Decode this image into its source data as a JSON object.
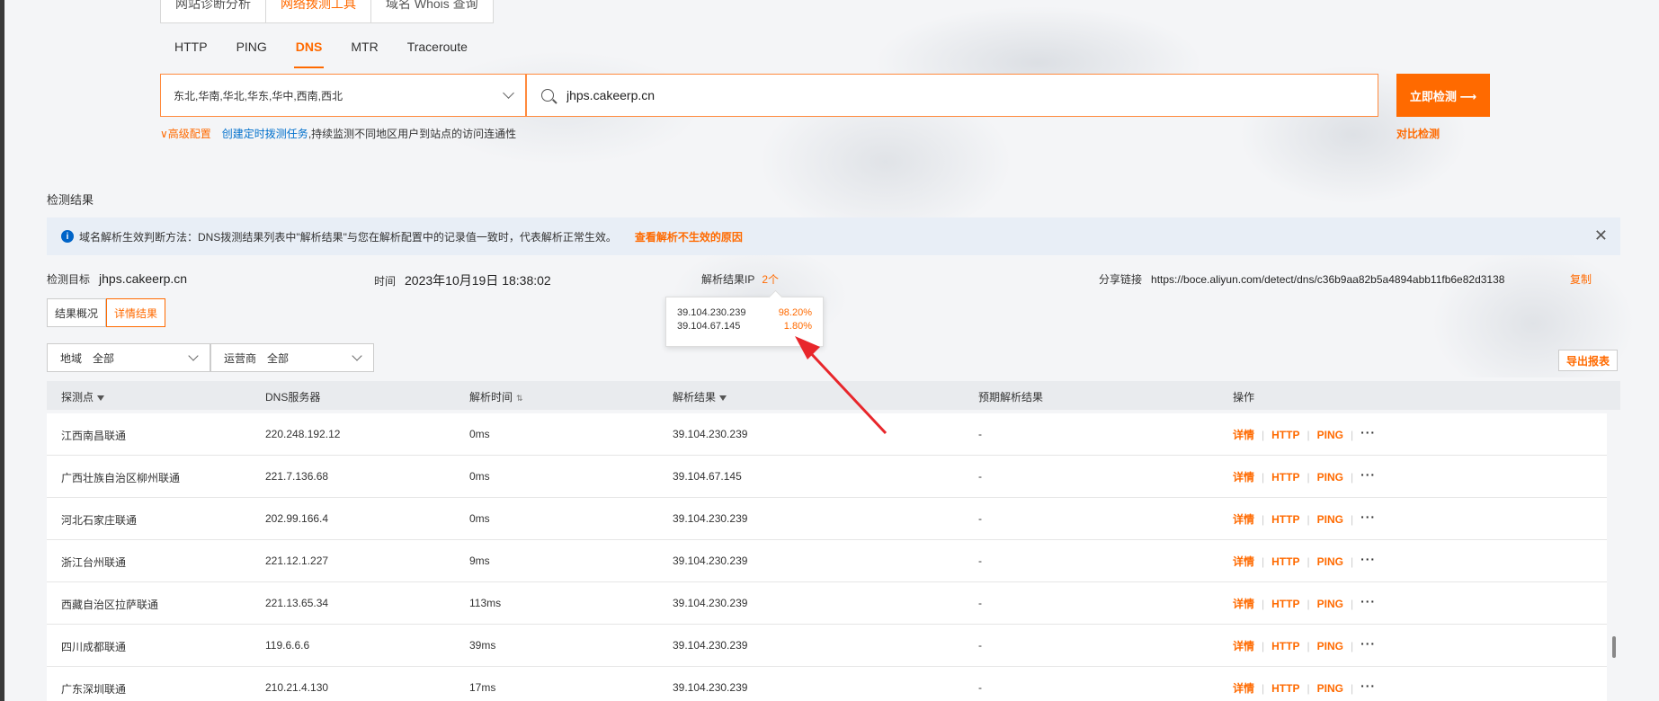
{
  "tool_tabs": [
    "网站诊断分析",
    "网络拨测工具",
    "域名 Whois 查询"
  ],
  "protocol_tabs": [
    "HTTP",
    "PING",
    "DNS",
    "MTR",
    "Traceroute"
  ],
  "region_select": {
    "value": "东北,华南,华北,华东,华中,西南,西北",
    "chevron_icon": "chevron-down-icon"
  },
  "target_input": {
    "value": "jhps.cakeerp.cn",
    "icon": "search-icon"
  },
  "detect_button": "立即检测 ⟶",
  "advanced_config": "∨高级配置",
  "schedule_link": "创建定时拨测任务",
  "schedule_desc": ",持续监测不同地区用户到站点的访问连通性",
  "compare_link": "对比检测",
  "section_title": "检测结果",
  "info_bar": {
    "icon": "info-icon",
    "text": "域名解析生效判断方法：DNS拨测结果列表中\"解析结果\"与您在解析配置中的记录值一致时，代表解析正常生效。",
    "reason_link": "查看解析不生效的原因",
    "close": "✕"
  },
  "meta": {
    "target_label": "检测目标",
    "target_value": "jhps.cakeerp.cn",
    "time_label": "时间",
    "time_value": "2023年10月19日 18:38:02",
    "ip_label": "解析结果IP",
    "ip_count": "2个",
    "share_label": "分享链接",
    "share_url": "https://boce.aliyun.com/detect/dns/c36b9aa82b5a4894abb11fb6e82d3138",
    "copy": "复制"
  },
  "view_toggle": [
    "结果概况",
    "详情结果"
  ],
  "filters": [
    {
      "label": "地域",
      "value": "全部"
    },
    {
      "label": "运营商",
      "value": "全部"
    }
  ],
  "export_button": "导出报表",
  "tooltip": [
    {
      "ip": "39.104.230.239",
      "pct": "98.20%"
    },
    {
      "ip": "39.104.67.145",
      "pct": "1.80%"
    }
  ],
  "table": {
    "headers": [
      "探测点",
      "DNS服务器",
      "解析时间",
      "解析结果",
      "预期解析结果",
      "操作"
    ],
    "rows": [
      [
        "江西南昌联通",
        "220.248.192.12",
        "0ms",
        "39.104.230.239",
        "-"
      ],
      [
        "广西壮族自治区柳州联通",
        "221.7.136.68",
        "0ms",
        "39.104.67.145",
        "-"
      ],
      [
        "河北石家庄联通",
        "202.99.166.4",
        "0ms",
        "39.104.230.239",
        "-"
      ],
      [
        "浙江台州联通",
        "221.12.1.227",
        "9ms",
        "39.104.230.239",
        "-"
      ],
      [
        "西藏自治区拉萨联通",
        "221.13.65.34",
        "113ms",
        "39.104.230.239",
        "-"
      ],
      [
        "四川成都联通",
        "119.6.6.6",
        "39ms",
        "39.104.230.239",
        "-"
      ],
      [
        "广东深圳联通",
        "210.21.4.130",
        "17ms",
        "39.104.230.239",
        "-"
      ]
    ],
    "ops": [
      "详情",
      "HTTP",
      "PING",
      "···"
    ]
  },
  "colors": {
    "accent": "#ff6a00",
    "link_blue": "#0070cc",
    "arrow_red": "#e8262b"
  }
}
